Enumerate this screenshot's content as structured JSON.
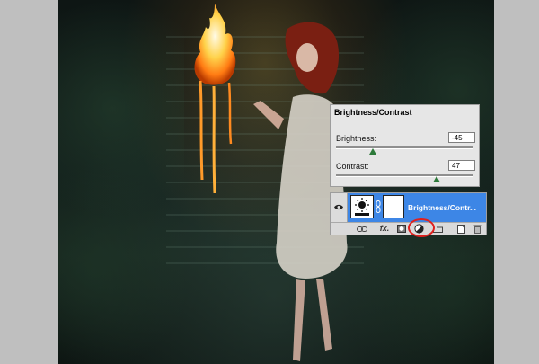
{
  "adjustments_panel": {
    "title": "Brightness/Contrast",
    "brightness": {
      "label": "Brightness:",
      "value": "-45",
      "slider_position": 0.27
    },
    "contrast": {
      "label": "Contrast:",
      "value": "47",
      "slider_position": 0.73
    }
  },
  "layers_panel": {
    "layer": {
      "name": "Brightness/Contr...",
      "visible": true,
      "selected": true
    },
    "toolbar_icons": [
      "link-layers-icon",
      "fx-icon",
      "add-mask-icon",
      "new-adjustment-layer-icon",
      "new-group-icon",
      "new-layer-icon",
      "delete-layer-icon"
    ],
    "fx_label": "fx.",
    "highlighted_button": "new-adjustment-layer-icon",
    "highlight_color": "#e0201e"
  },
  "colors": {
    "selected_layer": "#3d86e6",
    "slider_thumb": "#2d7a3a",
    "panel_bg": "#e6e6e6"
  }
}
